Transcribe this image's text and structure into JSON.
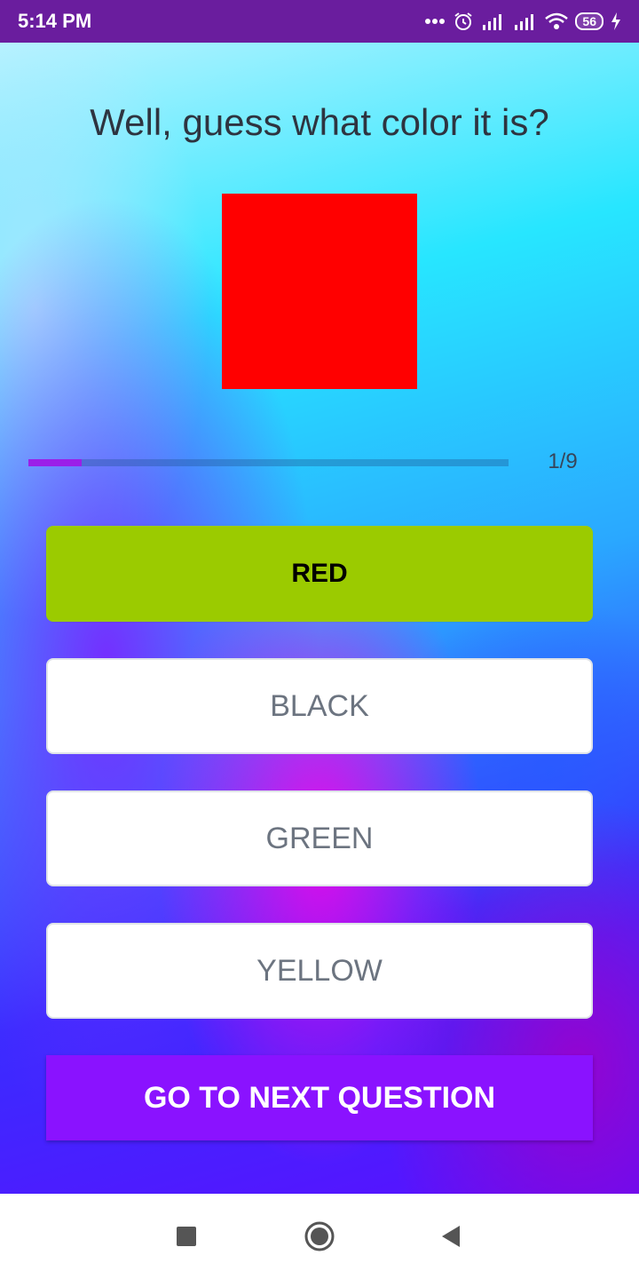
{
  "status_bar": {
    "time": "5:14 PM",
    "battery": "56",
    "icons": [
      "more-dots-icon",
      "alarm-icon",
      "signal-icon",
      "signal-icon",
      "wifi-icon",
      "battery-icon",
      "charging-icon"
    ]
  },
  "quiz": {
    "question": "Well, guess what color it is?",
    "swatch_color": "#ff0000",
    "progress": {
      "label": "1/9",
      "current": 1,
      "total": 9,
      "fill_color": "#9b1fe8"
    },
    "options": [
      {
        "label": "RED",
        "selected": true,
        "bg": "#9bcb00"
      },
      {
        "label": "BLACK",
        "selected": false
      },
      {
        "label": "GREEN",
        "selected": false
      },
      {
        "label": "YELLOW",
        "selected": false
      }
    ],
    "next_button": {
      "label": "GO TO NEXT QUESTION",
      "bg": "#8a12ff"
    }
  },
  "nav_bar": {
    "icons": [
      "recents-square-icon",
      "home-circle-icon",
      "back-triangle-icon"
    ]
  }
}
